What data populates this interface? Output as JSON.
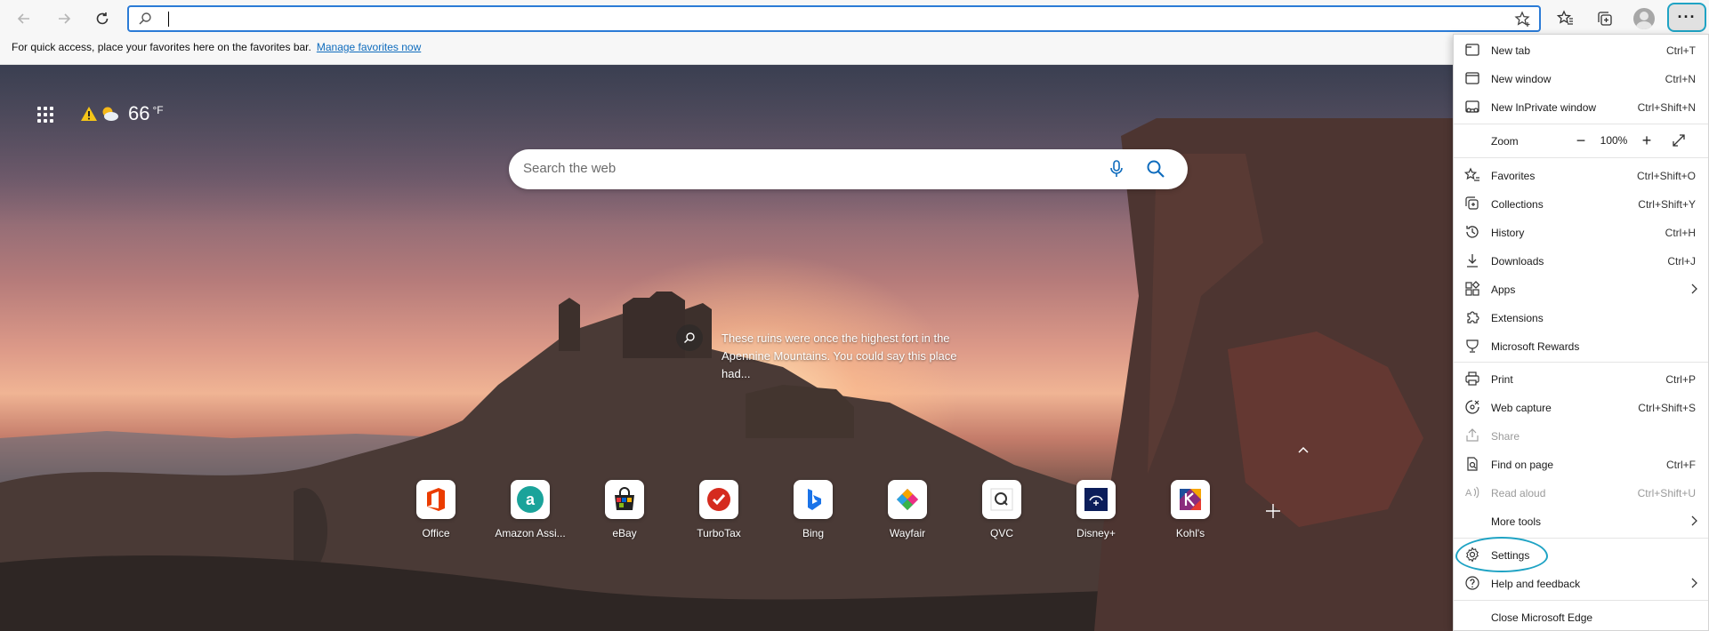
{
  "toolbar": {
    "address_value": "",
    "icons": [
      "back-icon",
      "forward-icon",
      "refresh-icon",
      "search-icon",
      "add-favorite-icon",
      "favorites-icon",
      "collections-icon",
      "profile-icon",
      "more-icon"
    ],
    "more_label": "···"
  },
  "favorites_bar": {
    "message": "For quick access, place your favorites here on the favorites bar.",
    "link": "Manage favorites now"
  },
  "newtab": {
    "weather": {
      "temp": "66",
      "unit": "°F"
    },
    "search_placeholder": "Search the web",
    "image_info": "These ruins were once the highest fort in the Apennine Mountains. You could say this place had...",
    "quick_links": [
      {
        "label": "Office",
        "icon": "office-icon"
      },
      {
        "label": "Amazon Assi...",
        "icon": "amazon-icon"
      },
      {
        "label": "eBay",
        "icon": "ebay-icon"
      },
      {
        "label": "TurboTax",
        "icon": "turbotax-icon"
      },
      {
        "label": "Bing",
        "icon": "bing-icon"
      },
      {
        "label": "Wayfair",
        "icon": "wayfair-icon"
      },
      {
        "label": "QVC",
        "icon": "qvc-icon"
      },
      {
        "label": "Disney+",
        "icon": "disney-icon"
      },
      {
        "label": "Kohl's",
        "icon": "kohls-icon"
      }
    ]
  },
  "menu": {
    "items": [
      {
        "label": "New tab",
        "shortcut": "Ctrl+T"
      },
      {
        "label": "New window",
        "shortcut": "Ctrl+N"
      },
      {
        "label": "New InPrivate window",
        "shortcut": "Ctrl+Shift+N"
      },
      {
        "label": "Zoom",
        "value": "100%"
      },
      {
        "label": "Favorites",
        "shortcut": "Ctrl+Shift+O"
      },
      {
        "label": "Collections",
        "shortcut": "Ctrl+Shift+Y"
      },
      {
        "label": "History",
        "shortcut": "Ctrl+H"
      },
      {
        "label": "Downloads",
        "shortcut": "Ctrl+J"
      },
      {
        "label": "Apps",
        "shortcut": ""
      },
      {
        "label": "Extensions",
        "shortcut": ""
      },
      {
        "label": "Microsoft Rewards",
        "shortcut": ""
      },
      {
        "label": "Print",
        "shortcut": "Ctrl+P"
      },
      {
        "label": "Web capture",
        "shortcut": "Ctrl+Shift+S"
      },
      {
        "label": "Share",
        "shortcut": ""
      },
      {
        "label": "Find on page",
        "shortcut": "Ctrl+F"
      },
      {
        "label": "Read aloud",
        "shortcut": "Ctrl+Shift+U"
      },
      {
        "label": "More tools",
        "shortcut": ""
      },
      {
        "label": "Settings",
        "shortcut": ""
      },
      {
        "label": "Help and feedback",
        "shortcut": ""
      },
      {
        "label": "Close Microsoft Edge",
        "shortcut": ""
      }
    ],
    "highlight_color": "#1fa3c4",
    "link_color": "#0f6cbd"
  }
}
